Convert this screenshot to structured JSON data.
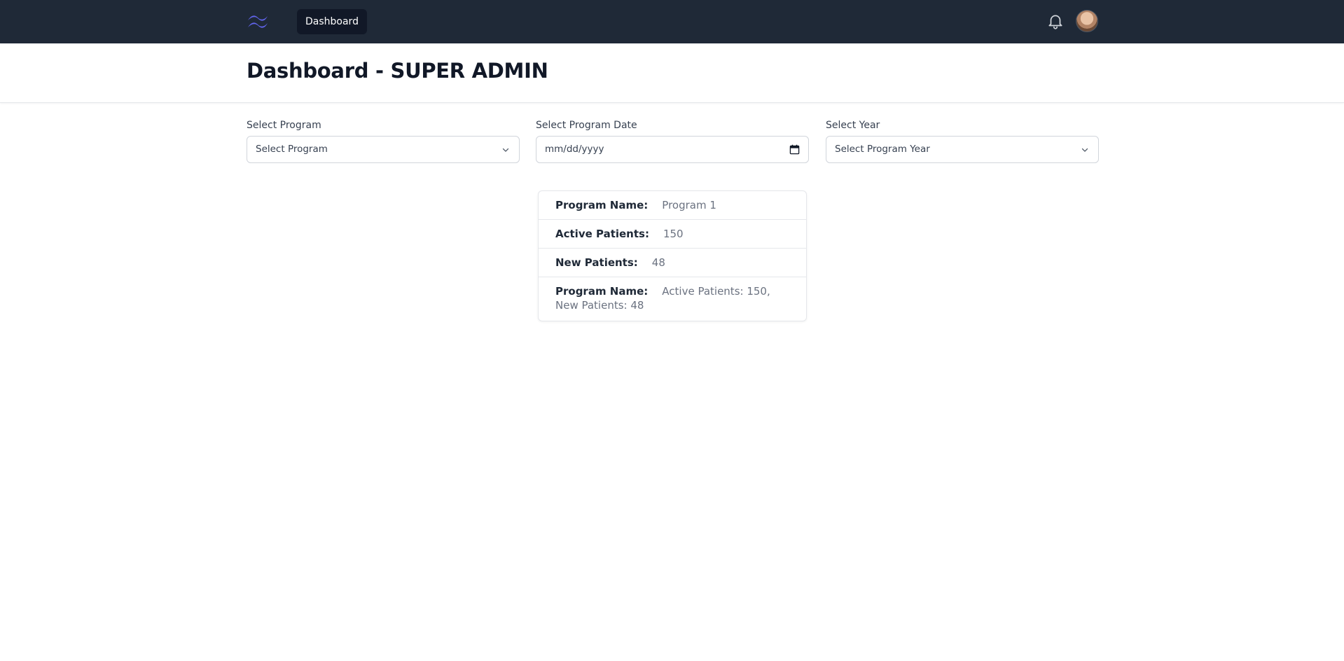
{
  "nav": {
    "logo_icon": "wave-logo-icon",
    "tab_label": "Dashboard",
    "notification_icon": "bell-icon",
    "avatar_icon": "user-avatar",
    "accent_color": "#6366f1"
  },
  "header": {
    "title": "Dashboard - SUPER ADMIN"
  },
  "filters": {
    "program": {
      "label": "Select Program",
      "value": "Select Program"
    },
    "date": {
      "label": "Select Program Date",
      "value": "mm/dd/yyyy"
    },
    "year": {
      "label": "Select Year",
      "value": "Select Program Year"
    }
  },
  "card": {
    "rows": [
      {
        "label": "Program Name:",
        "value": "Program 1"
      },
      {
        "label": "Active Patients:",
        "value": "150"
      },
      {
        "label": "New Patients:",
        "value": "48"
      },
      {
        "label": "Program Name:",
        "value": "Active Patients: 150, New Patients: 48"
      }
    ]
  }
}
